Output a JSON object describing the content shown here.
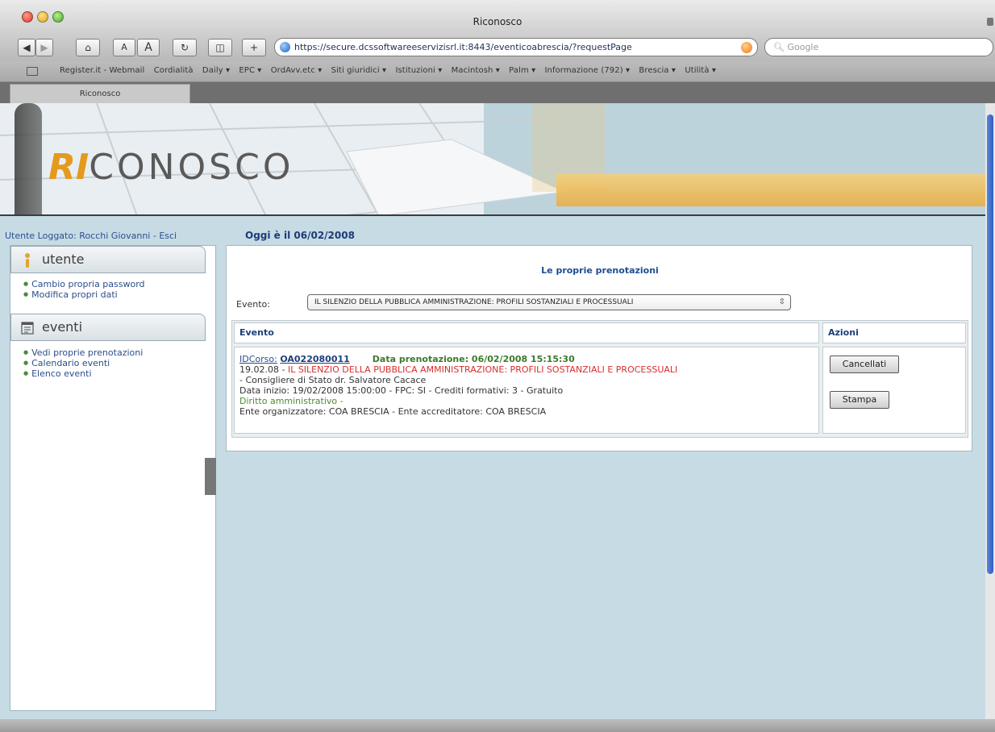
{
  "window": {
    "title": "Riconosco"
  },
  "toolbar": {
    "address": "https://secure.dcssoftwareeservizisrl.it:8443/eventicoabrescia/?requestPage",
    "search_placeholder": "Google",
    "text_small": "A",
    "text_large": "A"
  },
  "bookmarks": [
    "Register.it - Webmail",
    "Cordialità",
    "Daily ▾",
    "EPC ▾",
    "OrdAvv.etc ▾",
    "Siti giuridici ▾",
    "Istituzioni ▾",
    "Macintosh ▾",
    "Palm ▾",
    "Informazione (792) ▾",
    "Brescia ▾",
    "Utilità ▾"
  ],
  "tab": {
    "label": "Riconosco"
  },
  "banner": {
    "logo_ri": "RI",
    "logo_rest": "CONOSCO"
  },
  "user": {
    "logged_label": "Utente Loggato: Rocchi Giovanni - ",
    "exit": "Esci",
    "today": "Oggi è il 06/02/2008"
  },
  "sidebar": {
    "utente": {
      "title": "utente",
      "links": [
        "Cambio propria password",
        "Modifica propri dati"
      ]
    },
    "eventi": {
      "title": "eventi",
      "links": [
        "Vedi proprie prenotazioni",
        "Calendario eventi",
        "Elenco eventi"
      ]
    }
  },
  "main": {
    "title": "Le proprie prenotazioni",
    "evento_label": "Evento:",
    "evento_selected": "IL SILENZIO DELLA PUBBLICA AMMINISTRAZIONE: PROFILI SOSTANZIALI E PROCESSUALI",
    "col_evento": "Evento",
    "col_azioni": "Azioni",
    "row": {
      "idcorso_label": "IDCorso:",
      "idcorso": "OA022080011",
      "data_prenotazione": "Data prenotazione: 06/02/2008 15:15:30",
      "date_prefix": "19.02.08 - ",
      "title": "IL SILENZIO DELLA PUBBLICA AMMINISTRAZIONE: PROFILI SOSTANZIALI E PROCESSUALI",
      "speaker": "- Consigliere di Stato dr. Salvatore Cacace",
      "details": "Data inizio: 19/02/2008 15:00:00 - FPC: SI - Crediti formativi: 3 - Gratuito",
      "subject": "Diritto amministrativo -",
      "organizers": "Ente organizzatore: COA BRESCIA - Ente accreditatore: COA BRESCIA"
    },
    "btn_cancel": "Cancellati",
    "btn_print": "Stampa"
  }
}
